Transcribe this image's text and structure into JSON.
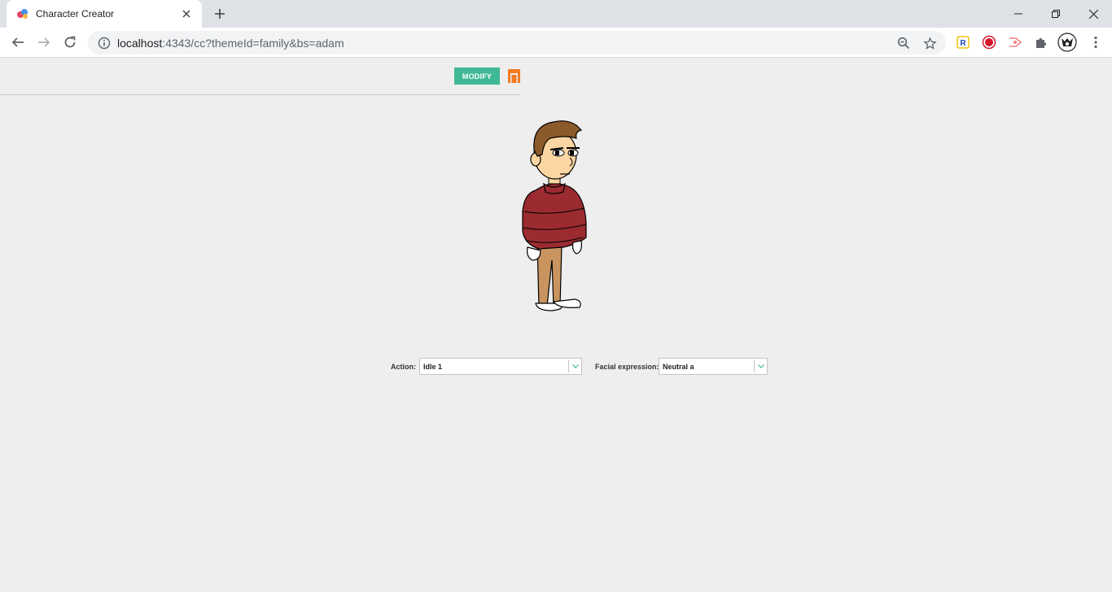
{
  "browser": {
    "tab": {
      "title": "Character Creator"
    },
    "url": {
      "host": "localhost",
      "rest": ":4343/cc?themeId=family&bs=adam"
    },
    "extensions": [
      "r-extension-icon",
      "record-icon",
      "cast-icon",
      "puzzle-icon",
      "profile-avatar"
    ]
  },
  "page": {
    "toolbar": {
      "modify_label": "MODIFY"
    },
    "controls": {
      "action": {
        "label": "Action:",
        "value": "Idle 1"
      },
      "facial": {
        "label": "Facial expression:",
        "value": "Neutral a"
      }
    }
  },
  "colors": {
    "modify_button": "#3fb896",
    "store_icon": "#f47b20",
    "jacket": "#9b2b31",
    "pants": "#c9945f",
    "hair": "#8b5a2b",
    "skin": "#fcd6a2"
  }
}
